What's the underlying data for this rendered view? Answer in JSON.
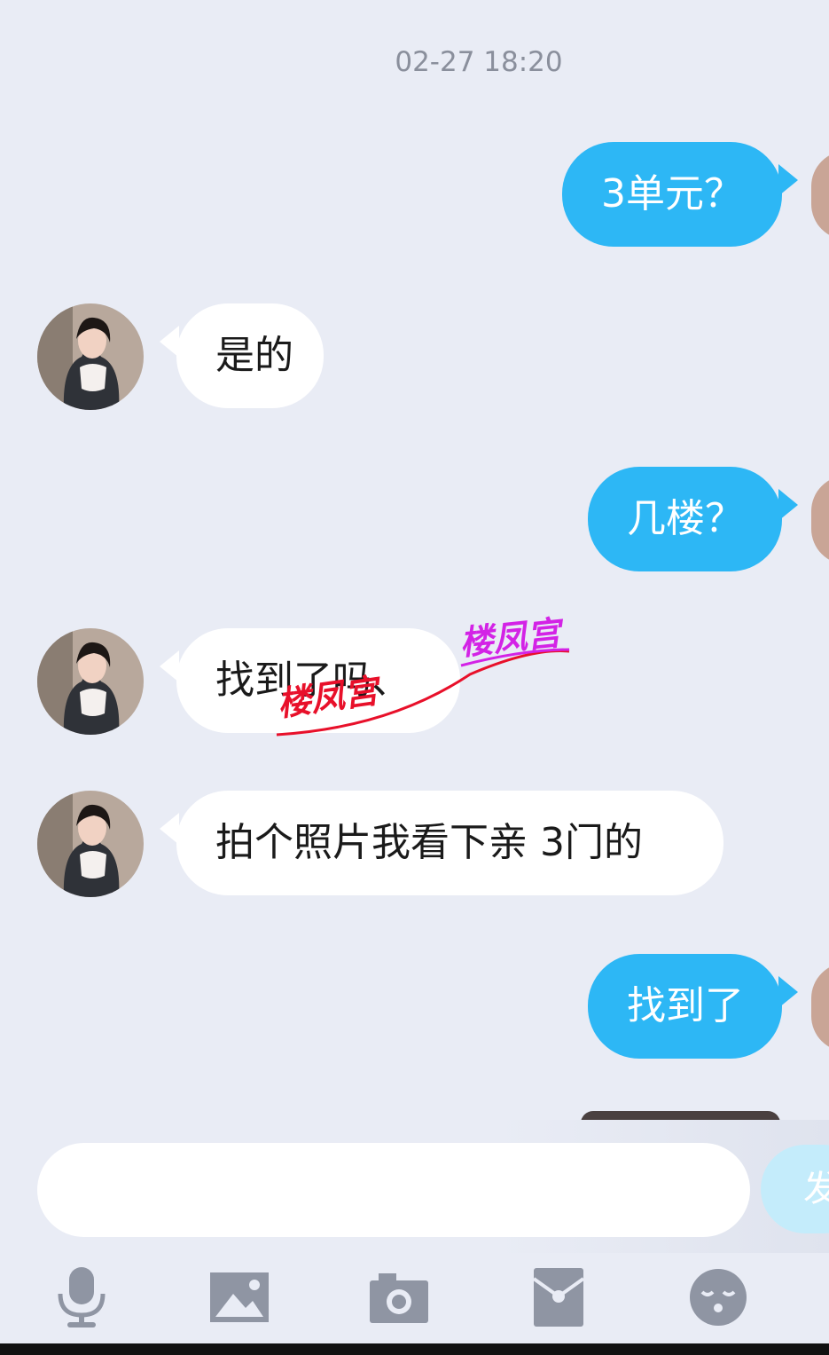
{
  "timestamp": "02-27 18:20",
  "messages": [
    {
      "side": "me",
      "text": "3单元？"
    },
    {
      "side": "them",
      "text": "是的"
    },
    {
      "side": "me",
      "text": "几楼？"
    },
    {
      "side": "them",
      "text": "找到了吗、"
    },
    {
      "side": "them",
      "text": "拍个照片我看下亲 3门的"
    },
    {
      "side": "me",
      "text": "找到了"
    }
  ],
  "watermark": "楼凤宫",
  "input": {
    "placeholder": "",
    "send_label": "发"
  },
  "toolbar": [
    "microphone-icon",
    "image-icon",
    "camera-icon",
    "red-packet-icon",
    "emoji-icon"
  ],
  "colors": {
    "background": "#e9ecf5",
    "my_bubble": "#2db7f5",
    "their_bubble": "#ffffff",
    "icon": "#8f95a3"
  }
}
